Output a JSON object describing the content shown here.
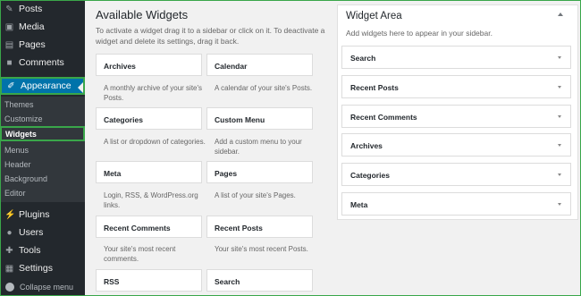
{
  "sidebar": {
    "items": [
      {
        "label": "Posts",
        "icon": "pin-icon"
      },
      {
        "label": "Media",
        "icon": "media-icon"
      },
      {
        "label": "Pages",
        "icon": "pages-icon"
      },
      {
        "label": "Comments",
        "icon": "comment-icon"
      }
    ],
    "appearance": {
      "label": "Appearance",
      "icon": "brush-icon"
    },
    "sub": {
      "themes": "Themes",
      "customize": "Customize",
      "widgets": "Widgets",
      "menus": "Menus",
      "header": "Header",
      "background": "Background",
      "editor": "Editor"
    },
    "bottom": [
      {
        "label": "Plugins",
        "icon": "plugin-icon"
      },
      {
        "label": "Users",
        "icon": "users-icon"
      },
      {
        "label": "Tools",
        "icon": "tools-icon"
      },
      {
        "label": "Settings",
        "icon": "settings-icon"
      }
    ],
    "collapse": "Collapse menu"
  },
  "available": {
    "title": "Available Widgets",
    "description": "To activate a widget drag it to a sidebar or click on it. To deactivate a widget and delete its settings, drag it back.",
    "widgets": [
      {
        "name": "Archives",
        "desc": "A monthly archive of your site's Posts."
      },
      {
        "name": "Calendar",
        "desc": "A calendar of your site's Posts."
      },
      {
        "name": "Categories",
        "desc": "A list or dropdown of categories."
      },
      {
        "name": "Custom Menu",
        "desc": "Add a custom menu to your sidebar."
      },
      {
        "name": "Meta",
        "desc": "Login, RSS, & WordPress.org links."
      },
      {
        "name": "Pages",
        "desc": "A list of your site's Pages."
      },
      {
        "name": "Recent Comments",
        "desc": "Your site's most recent comments."
      },
      {
        "name": "Recent Posts",
        "desc": "Your site's most recent Posts."
      },
      {
        "name": "RSS",
        "desc": ""
      },
      {
        "name": "Search",
        "desc": ""
      }
    ]
  },
  "area": {
    "title": "Widget Area",
    "description": "Add widgets here to appear in your sidebar.",
    "widgets": [
      "Search",
      "Recent Posts",
      "Recent Comments",
      "Archives",
      "Categories",
      "Meta"
    ]
  },
  "colors": {
    "accent": "#0073aa",
    "highlight": "#3aa64a",
    "sidebar": "#23282d"
  }
}
